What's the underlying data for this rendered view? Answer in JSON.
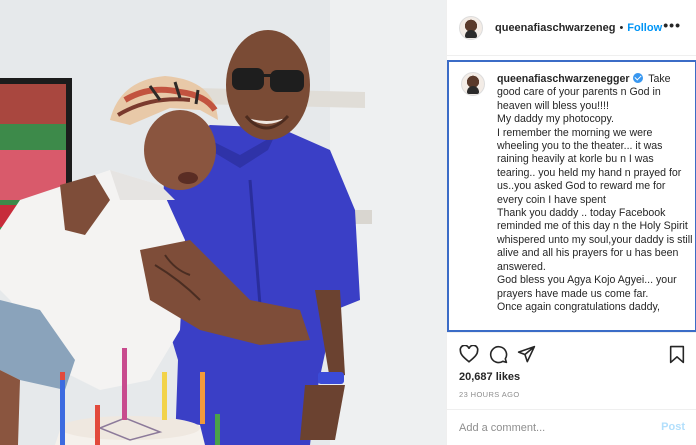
{
  "post": {
    "username": "queenafiaschwarzeneg",
    "separator": "•",
    "follow_label": "Follow",
    "more_label": "•••"
  },
  "caption": {
    "username": "queenafiaschwarzenegger",
    "lines": [
      "Take good care of your parents n God in heaven will bless you!!!!",
      "My daddy my photocopy.",
      "I remember the morning we were wheeling you to the theater... it was raining heavily at korle bu n I was tearing.. you held my hand n prayed for us..you asked God to reward me for every coin I have spent",
      "Thank you daddy .. today Facebook reminded me of this day n the Holy Spirit whispered unto my soul,your daddy is still alive and all his prayers for u has been answered.",
      "God bless you Agya Kojo Agyei... your prayers have made us come far.",
      "Once again congratulations daddy,"
    ]
  },
  "actions": {
    "likes": "20,687 likes",
    "time": "23 HOURS AGO"
  },
  "comment": {
    "placeholder": "Add a comment...",
    "post_label": "Post"
  },
  "colors": {
    "accent": "#0095f6",
    "post_disabled": "#b2dffc",
    "verified": "#3897f0",
    "border": "#efefef",
    "caption_frame": "#3b6cc7"
  },
  "icons": [
    "heart-icon",
    "comment-icon",
    "share-icon",
    "bookmark-icon",
    "verified-icon",
    "more-icon"
  ]
}
